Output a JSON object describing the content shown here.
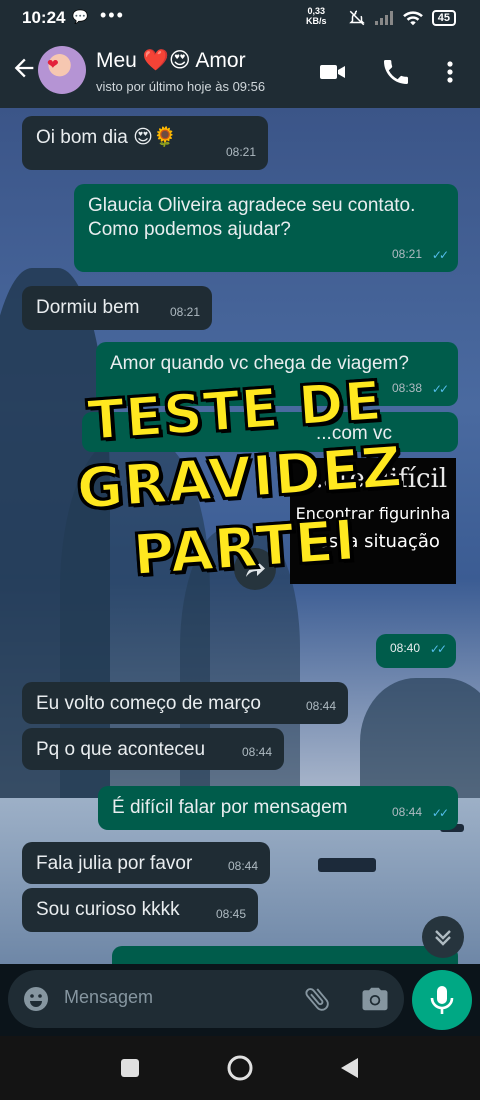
{
  "status_bar": {
    "time": "10:24",
    "dots": "•••",
    "net_speed_value": "0,33",
    "net_speed_unit": "KB/s",
    "battery": "45"
  },
  "header": {
    "contact_name": "Meu ❤️😍 Amor",
    "last_seen": "visto por último hoje às 09:56"
  },
  "messages": [
    {
      "dir": "in",
      "text": "Oi bom dia 😍🌻",
      "time": "08:21"
    },
    {
      "dir": "out",
      "text": "Glaucia Oliveira agradece seu contato. Como podemos ajudar?",
      "time": "08:21"
    },
    {
      "dir": "in",
      "text": "Dormiu bem",
      "time": "08:21"
    },
    {
      "dir": "out",
      "text": "Amor quando vc chega de viagem?",
      "time": "08:38"
    },
    {
      "dir": "out",
      "text": "...com vc",
      "time": ""
    },
    {
      "dir": "out",
      "type": "sticker",
      "time": "08:40"
    },
    {
      "dir": "in",
      "text": "Eu volto começo de março",
      "time": "08:44"
    },
    {
      "dir": "in",
      "text": "Pq o que aconteceu",
      "time": "08:44"
    },
    {
      "dir": "out",
      "text": "É difícil falar por mensagem",
      "time": "08:44"
    },
    {
      "dir": "in",
      "text": "Fala julia por favor",
      "time": "08:44"
    },
    {
      "dir": "in",
      "text": "Sou curioso kkkk",
      "time": "08:45"
    }
  ],
  "sticker": {
    "line1": "...ate difícil",
    "line2": "Encontrar figurinha",
    "line3": "nessa situação"
  },
  "overlay": {
    "line1": "TESTE DE",
    "line2": "GRAVIDEZ PARTEI"
  },
  "composer": {
    "placeholder": "Mensagem"
  },
  "colors": {
    "incoming_bubble": "#1f2c34",
    "outgoing_bubble": "#005c4b",
    "accent": "#00a884",
    "read_ticks": "#53bdeb",
    "overlay_text": "#ffe81f"
  }
}
